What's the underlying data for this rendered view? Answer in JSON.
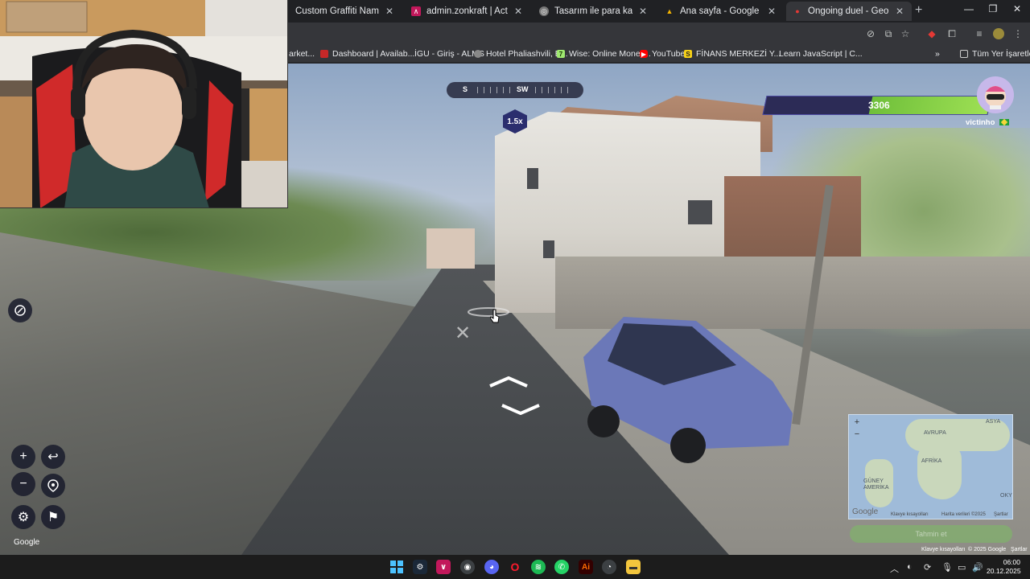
{
  "browser": {
    "tabs": [
      {
        "title": "Custom Graffiti Name Metal Si",
        "icon": "store-favicon",
        "color": "#555"
      },
      {
        "title": "admin.zonkraft | Active Orders",
        "icon": "admin-favicon",
        "color": "#c2185b"
      },
      {
        "title": "Tasarım ile para kazanma",
        "icon": "globe-favicon",
        "color": "#777"
      },
      {
        "title": "Ana sayfa - Google Drive",
        "icon": "drive-favicon",
        "color": "#f4b400"
      },
      {
        "title": "Ongoing duel - GeoGuessr",
        "icon": "geoguessr-favicon",
        "color": "#e53935",
        "active": true
      }
    ],
    "bookmarks": [
      {
        "label": "arket...",
        "color": "#666"
      },
      {
        "label": "Dashboard | Availab...",
        "color": "#c62828"
      },
      {
        "label": "İGU - Giriş - ALMS",
        "color": "#666"
      },
      {
        "label": "Hotel Phaliashvili, B...",
        "color": "#888"
      },
      {
        "label": "Wise: Online Money...",
        "color": "#9fe870"
      },
      {
        "label": "YouTube",
        "color": "#ff0000"
      },
      {
        "label": "FİNANS MERKEZİ Y...",
        "color": "#f7d117"
      },
      {
        "label": "Learn JavaScript | C...",
        "color": "#555"
      }
    ],
    "bookmarks_more": "»",
    "all_bookmarks": "Tüm Yer İşaretleri"
  },
  "hud": {
    "compass": {
      "labels": [
        "S",
        "SW"
      ]
    },
    "zoom": "1.5x",
    "health": {
      "value": "3306",
      "fraction": 0.53,
      "color": "#8cd449"
    },
    "player": {
      "name": "victinho"
    }
  },
  "controls": {
    "zoom_in": "+",
    "zoom_out": "−",
    "back_icon": "↩",
    "watermark": "Google"
  },
  "minimap": {
    "labels": [
      "ASYA",
      "AVRUPA",
      "AFRİKA",
      "GÜNEY AMERİKA",
      "OKY"
    ],
    "google": "Google",
    "footer": [
      "Klavye kısayolları",
      "Harita verileri ©2025",
      "Şartlar"
    ],
    "guess_button": "Tahmin et"
  },
  "street_footer": [
    "Klavye kısayolları",
    "© 2025 Google",
    "Şartlar"
  ],
  "taskbar": {
    "time": "06:00",
    "date": "20.12.2025"
  }
}
